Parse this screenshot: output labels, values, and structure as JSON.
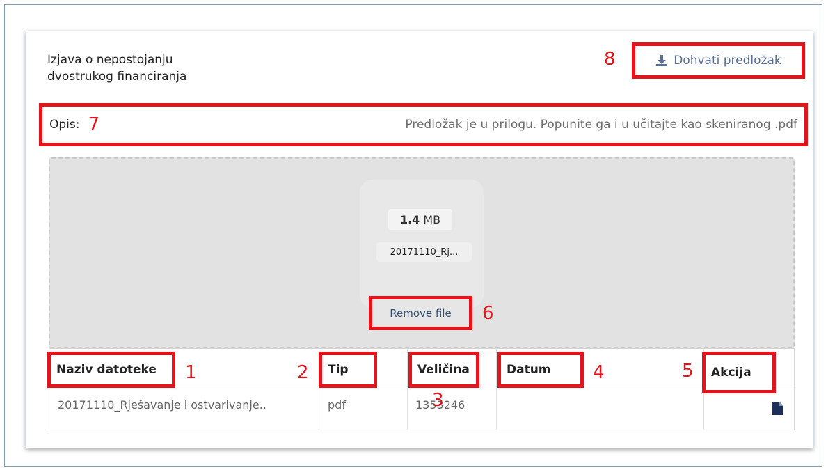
{
  "card": {
    "title_line1": "Izjava o nepostojanju",
    "title_line2": "dvostrukog financiranja",
    "download_label": "Dohvati predložak",
    "download_icon": "download-icon",
    "description_label": "Opis:",
    "description_text": "Predložak je u prilogu. Popunite ga i u učitajte kao skeniranog .pdf"
  },
  "upload": {
    "size_value": "1.4",
    "size_unit": "MB",
    "file_name_short": "20171110_Rj...",
    "remove_label": "Remove file"
  },
  "table": {
    "headers": [
      "Naziv datoteke",
      "Tip",
      "Veličina",
      "Datum",
      "Akcija"
    ],
    "rows": [
      {
        "name": "20171110_Rješavanje i ostvarivanje..",
        "type": "pdf",
        "size": "1353246",
        "date": "",
        "action_icon": "file-icon"
      }
    ]
  },
  "annotations": {
    "m1": "1",
    "m2": "2",
    "m3": "3",
    "m4": "4",
    "m5": "5",
    "m6": "6",
    "m7": "7",
    "m8": "8",
    "color": "#e3141c"
  },
  "colors": {
    "link": "#5b6e96",
    "dropzone_bg": "#e2e2e2",
    "annotation_red": "#e3141c"
  }
}
